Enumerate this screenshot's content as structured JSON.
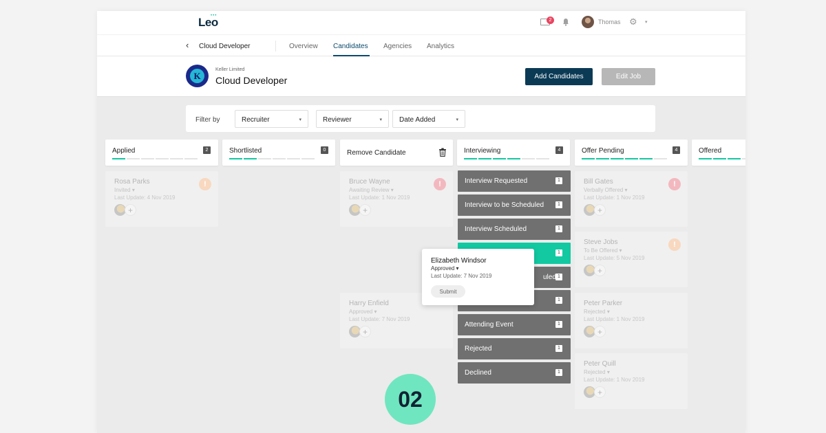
{
  "topbar": {
    "logo": "Leo",
    "logo_dots": "•••",
    "mail_count": "2",
    "username": "Thomas",
    "gear": "⚙",
    "caret": "▾"
  },
  "nav": {
    "back": "‹",
    "job": "Cloud Developer",
    "tabs": [
      "Overview",
      "Candidates",
      "Agencies",
      "Analytics"
    ],
    "active_tab": "Candidates"
  },
  "job": {
    "logo_letter": "K",
    "company": "Keller Limited",
    "title": "Cloud Developer",
    "add_label": "Add Candidates",
    "edit_label": "Edit Job"
  },
  "filter": {
    "label": "Filter by",
    "selects": [
      "Recruiter",
      "Reviewer",
      "Date Added"
    ],
    "caret": "▾"
  },
  "columns": {
    "applied": {
      "title": "Applied",
      "count": "2"
    },
    "shortlisted": {
      "title": "Shortlisted",
      "count": "0"
    },
    "remove": {
      "title": "Remove Candidate"
    },
    "interviewing": {
      "title": "Interviewing",
      "count": "4"
    },
    "offer_pending": {
      "title": "Offer Pending",
      "count": "4"
    },
    "offered": {
      "title": "Offered"
    }
  },
  "cards": {
    "rosa": {
      "name": "Rosa Parks",
      "status": "Invited",
      "update": "Last Update: 4 Nov 2019"
    },
    "bruce": {
      "name": "Bruce Wayne",
      "status": "Awaiting Review",
      "update": "Last Update: 1 Nov 2019"
    },
    "harry": {
      "name": "Harry Enfield",
      "status": "Approved",
      "update": "Last Update: 7 Nov 2019"
    },
    "bill": {
      "name": "Bill Gates",
      "status": "Verbally Offered",
      "update": "Last Update: 1 Nov 2019"
    },
    "steve": {
      "name": "Steve Jobs",
      "status": "To Be Offered",
      "update": "Last Update: 5 Nov 2019"
    },
    "peter_parker": {
      "name": "Peter Parker",
      "status": "Rejected",
      "update": "Last Update: 1 Nov 2019"
    },
    "peter_quill": {
      "name": "Peter Quill",
      "status": "Rejected",
      "update": "Last Update: 1 Nov 2019"
    },
    "caret": "▾",
    "add": "+",
    "alert": "!"
  },
  "stages": [
    {
      "label": "Interview Requested",
      "count": "1"
    },
    {
      "label": "Interview to be Scheduled",
      "count": "1"
    },
    {
      "label": "Interview Scheduled",
      "count": "1"
    },
    {
      "label": "",
      "count": "1"
    },
    {
      "label": "uled",
      "count": "1"
    },
    {
      "label": "",
      "count": "1"
    },
    {
      "label": "Attending Event",
      "count": "1"
    },
    {
      "label": "Rejected",
      "count": "1"
    },
    {
      "label": "Declined",
      "count": "1"
    }
  ],
  "popup": {
    "name": "Elizabeth Windsor",
    "status": "Approved",
    "update": "Last Update: 7 Nov 2019",
    "submit": "Submit"
  },
  "step_badge": "02",
  "colors": {
    "primary": "#0b3a55",
    "accent": "#12c9a2",
    "badge": "#6fe6bf",
    "alert_red": "#e84560"
  }
}
